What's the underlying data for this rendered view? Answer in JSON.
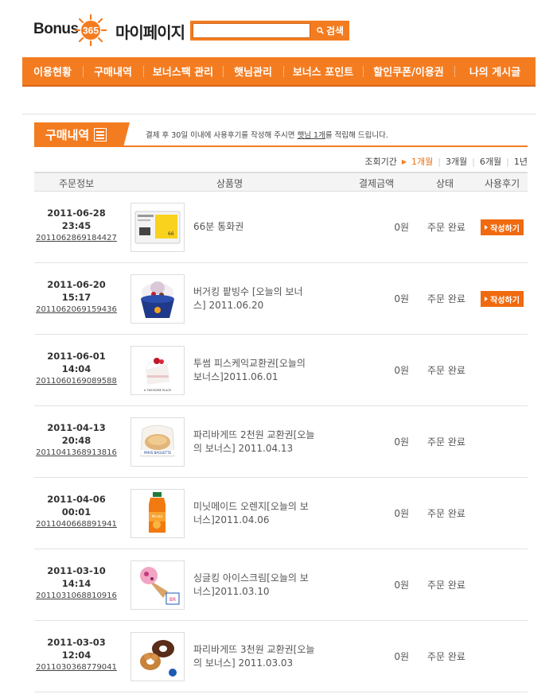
{
  "header": {
    "logo_text": "Bonus",
    "logo_number": "365",
    "title": "마이페이지",
    "search_placeholder": "",
    "search_label": "검색"
  },
  "nav": [
    {
      "label": "이용현황",
      "w": 76
    },
    {
      "label": "구매내역",
      "w": 76
    },
    {
      "label": "보너스팩 관리",
      "w": 100
    },
    {
      "label": "햇님관리",
      "w": 76
    },
    {
      "label": "보너스 포인트",
      "w": 100
    },
    {
      "label": "할인쿠폰/이용권",
      "w": 115
    },
    {
      "label": "나의 게시글",
      "w": 102
    }
  ],
  "section": {
    "title": "구매내역",
    "notice_pre": "결제 후 30일 이내에 사용후기를 작성해 주시면 ",
    "notice_hl": "햇님 1개",
    "notice_post": "를 적립해 드립니다."
  },
  "period": {
    "label": "조회기간",
    "options": [
      "1개월",
      "3개월",
      "6개월",
      "1년"
    ],
    "selected": "1개월"
  },
  "columns": [
    "주문정보",
    "상품명",
    "결제금액",
    "상태",
    "사용후기"
  ],
  "write_label": "작성하기",
  "orders": [
    {
      "date": "2011-06-28",
      "time": "23:45",
      "order_no": "2011062869184427",
      "name_l1": "66분 통화권",
      "name_l2": "",
      "price": "0원",
      "status": "주문 완료",
      "review": true,
      "thumb": "phone-card"
    },
    {
      "date": "2011-06-20",
      "time": "15:17",
      "order_no": "2011062069159436",
      "name_l1": "버거킹 팥빙수 [오늘의 보너",
      "name_l2": "스] 2011.06.20",
      "price": "0원",
      "status": "주문 완료",
      "review": true,
      "thumb": "bingsu"
    },
    {
      "date": "2011-06-01",
      "time": "14:04",
      "order_no": "2011060169089588",
      "name_l1": "투썸 피스케익교환권[오늘의",
      "name_l2": "보너스]2011.06.01",
      "price": "0원",
      "status": "주문 완료",
      "review": false,
      "thumb": "cake"
    },
    {
      "date": "2011-04-13",
      "time": "20:48",
      "order_no": "2011041368913816",
      "name_l1": "파리바게뜨 2천원 교환권[오늘",
      "name_l2": "의 보너스] 2011.04.13",
      "price": "0원",
      "status": "주문 완료",
      "review": false,
      "thumb": "bread"
    },
    {
      "date": "2011-04-06",
      "time": "00:01",
      "order_no": "2011040668891941",
      "name_l1": "미닛메이드 오렌지[오늘의 보",
      "name_l2": "너스]2011.04.06",
      "price": "0원",
      "status": "주문 완료",
      "review": false,
      "thumb": "juice"
    },
    {
      "date": "2011-03-10",
      "time": "14:14",
      "order_no": "2011031068810916",
      "name_l1": "싱글킹 아이스크림[오늘의 보",
      "name_l2": "너스]2011.03.10",
      "price": "0원",
      "status": "주문 완료",
      "review": false,
      "thumb": "icecream"
    },
    {
      "date": "2011-03-03",
      "time": "12:04",
      "order_no": "2011030368779041",
      "name_l1": "파리바게뜨 3천원 교환권[오늘",
      "name_l2": "의 보너스] 2011.03.03",
      "price": "0원",
      "status": "주문 완료",
      "review": false,
      "thumb": "donut"
    }
  ]
}
